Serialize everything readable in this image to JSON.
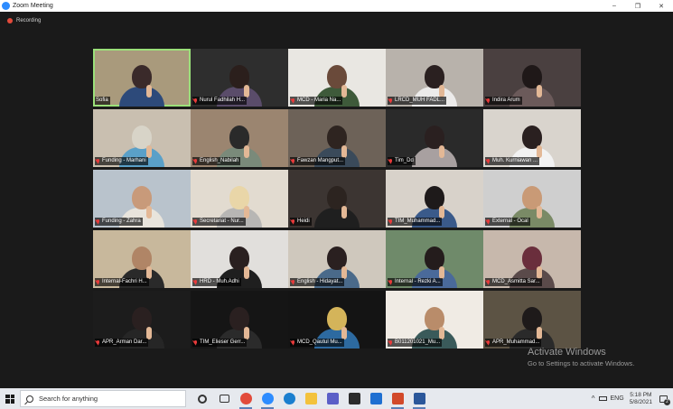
{
  "window": {
    "title": "Zoom Meeting",
    "minimize": "–",
    "restore": "❐",
    "close": "✕"
  },
  "recording": {
    "label": "Recording"
  },
  "participants": [
    {
      "name": "Sofia",
      "active": true,
      "muted": false
    },
    {
      "name": "Nurul Fadhilah H...",
      "active": false,
      "muted": true
    },
    {
      "name": "MCD - Maria Na...",
      "active": false,
      "muted": true
    },
    {
      "name": "LRCD_MUH FADL...",
      "active": false,
      "muted": true
    },
    {
      "name": "Indira Arum",
      "active": false,
      "muted": true
    },
    {
      "name": "Funding - Marhani",
      "active": false,
      "muted": true
    },
    {
      "name": "English_Nabilah",
      "active": false,
      "muted": true
    },
    {
      "name": "Fawzan Mangput...",
      "active": false,
      "muted": true
    },
    {
      "name": "Tim_Dd",
      "active": false,
      "muted": true
    },
    {
      "name": "Muh. Kurniawan ...",
      "active": false,
      "muted": true
    },
    {
      "name": "Funding - Zahra",
      "active": false,
      "muted": true
    },
    {
      "name": "Secretariat - Nur...",
      "active": false,
      "muted": true
    },
    {
      "name": "Heidi",
      "active": false,
      "muted": true
    },
    {
      "name": "TIM_Muhammad...",
      "active": false,
      "muted": true
    },
    {
      "name": "External - Ocal",
      "active": false,
      "muted": true
    },
    {
      "name": "Internal-Fachri H...",
      "active": false,
      "muted": true
    },
    {
      "name": "HRD - Muh.Adhi",
      "active": false,
      "muted": true
    },
    {
      "name": "English - Hidayat...",
      "active": false,
      "muted": true
    },
    {
      "name": "Internal - Rezki A...",
      "active": false,
      "muted": true
    },
    {
      "name": "MCD_Asmitta Sar...",
      "active": false,
      "muted": true
    },
    {
      "name": "APR_Arman Dar...",
      "active": false,
      "muted": true
    },
    {
      "name": "TIM_Elieser Gerr...",
      "active": false,
      "muted": true
    },
    {
      "name": "MCD_Qautul Mu...",
      "active": false,
      "muted": true
    },
    {
      "name": "B011201021_Mu...",
      "active": false,
      "muted": true
    },
    {
      "name": "APR_Muhammad...",
      "active": false,
      "muted": true
    }
  ],
  "watermark": {
    "line1": "Activate Windows",
    "line2": "Go to Settings to activate Windows."
  },
  "taskbar": {
    "search_placeholder": "Search for anything",
    "apps": [
      "cortana-icon",
      "task-view-icon",
      "chrome-icon",
      "zoom-icon",
      "edge-icon",
      "file-explorer-icon",
      "teams-icon",
      "store-icon",
      "mail-icon",
      "powerpoint-icon",
      "word-icon"
    ],
    "tray": {
      "caret": "^",
      "language": "ENG",
      "time": "5:18 PM",
      "date": "5/8/2021",
      "notifications": "2"
    }
  }
}
